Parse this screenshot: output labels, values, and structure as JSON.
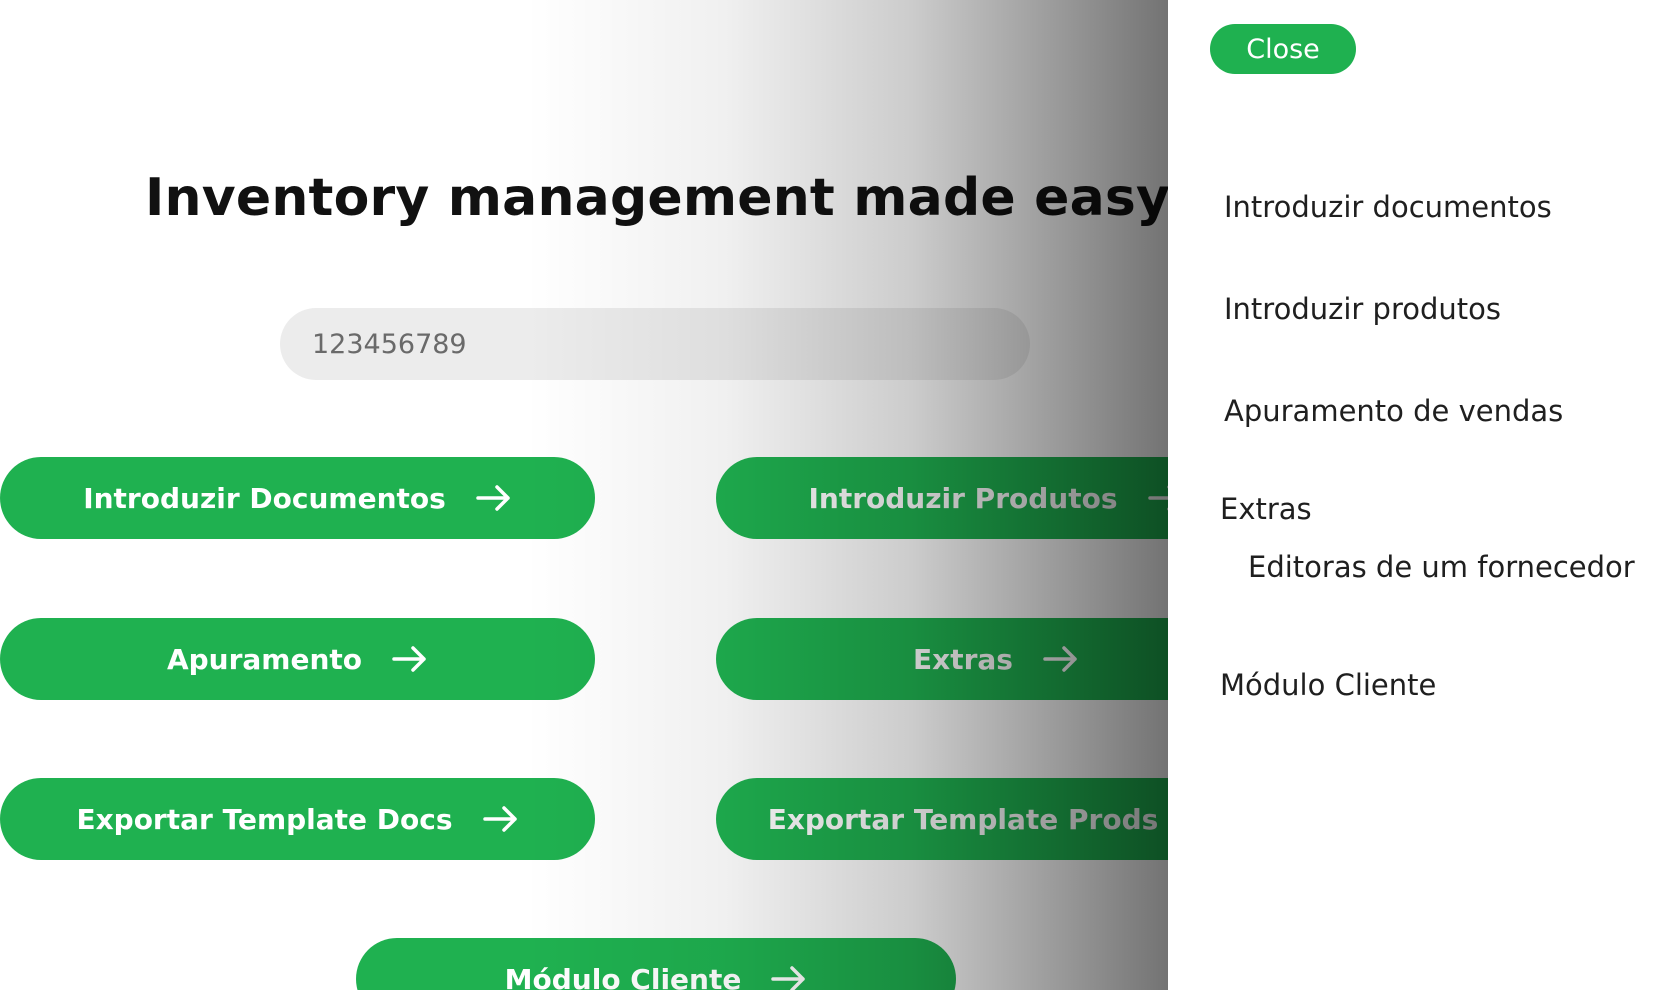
{
  "main": {
    "title": "Inventory management made easy",
    "search_input": {
      "value": "123456789"
    },
    "buttons": {
      "introduzir_documentos": "Introduzir Documentos",
      "introduzir_produtos": "Introduzir Produtos",
      "apuramento": "Apuramento",
      "extras": "Extras",
      "exportar_template_docs": "Exportar Template Docs",
      "exportar_template_prods": "Exportar Template Prods",
      "modulo_cliente": "Módulo Cliente"
    },
    "button_icon": "arrow-right-icon"
  },
  "drawer": {
    "close_label": "Close",
    "items": [
      "Introduzir documentos",
      "Introduzir produtos",
      "Apuramento de vendas"
    ],
    "extras": {
      "label": "Extras",
      "subitems": [
        "Editoras de um fornecedor"
      ]
    },
    "modulo_cliente": "Módulo Cliente"
  },
  "colors": {
    "accent_green": "#1fb150",
    "title_text": "#111111",
    "input_background": "#ececec"
  }
}
